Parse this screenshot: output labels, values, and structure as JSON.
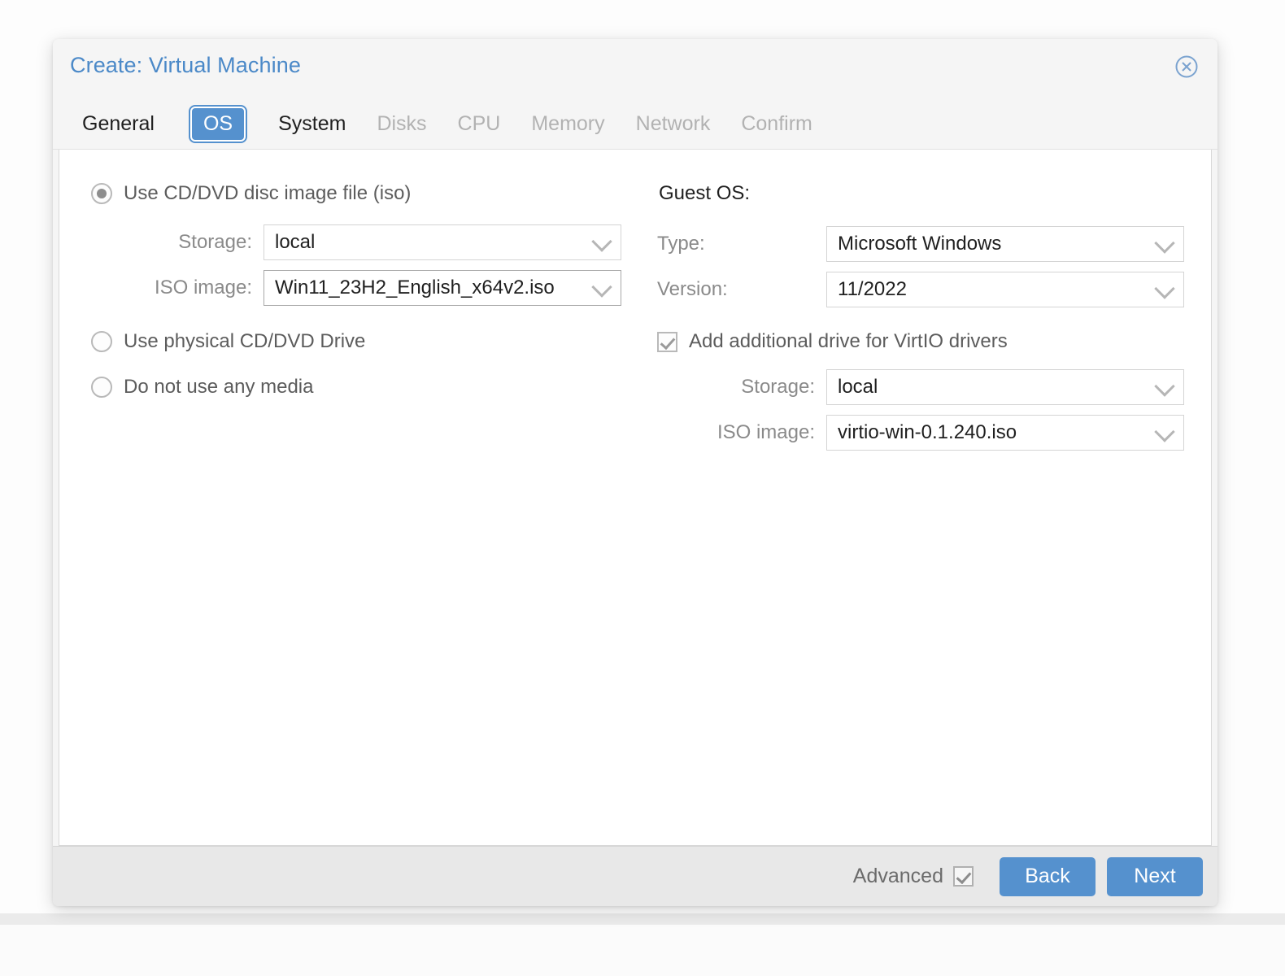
{
  "dialog": {
    "title": "Create: Virtual Machine",
    "close_icon": "close-circle-icon"
  },
  "tabs": [
    {
      "label": "General",
      "state": "enabled"
    },
    {
      "label": "OS",
      "state": "active"
    },
    {
      "label": "System",
      "state": "enabled"
    },
    {
      "label": "Disks",
      "state": "disabled"
    },
    {
      "label": "CPU",
      "state": "disabled"
    },
    {
      "label": "Memory",
      "state": "disabled"
    },
    {
      "label": "Network",
      "state": "disabled"
    },
    {
      "label": "Confirm",
      "state": "disabled"
    }
  ],
  "media": {
    "options": [
      {
        "label": "Use CD/DVD disc image file (iso)",
        "selected": true
      },
      {
        "label": "Use physical CD/DVD Drive",
        "selected": false
      },
      {
        "label": "Do not use any media",
        "selected": false
      }
    ],
    "storage_label": "Storage:",
    "storage_value": "local",
    "iso_label": "ISO image:",
    "iso_value": "Win11_23H2_English_x64v2.iso"
  },
  "guest_os": {
    "heading": "Guest OS:",
    "type_label": "Type:",
    "type_value": "Microsoft Windows",
    "version_label": "Version:",
    "version_value": "11/2022",
    "virtio_label": "Add additional drive for VirtIO drivers",
    "virtio_checked": true,
    "virtio_storage_label": "Storage:",
    "virtio_storage_value": "local",
    "virtio_iso_label": "ISO image:",
    "virtio_iso_value": "virtio-win-0.1.240.iso"
  },
  "footer": {
    "advanced_label": "Advanced",
    "advanced_checked": true,
    "back_label": "Back",
    "next_label": "Next"
  },
  "colors": {
    "accent": "#5591ce",
    "title": "#4b89c8",
    "disabled_text": "#b2b2b2",
    "label_text": "#8a8a8a",
    "footer_bg": "#e8e8e8"
  }
}
